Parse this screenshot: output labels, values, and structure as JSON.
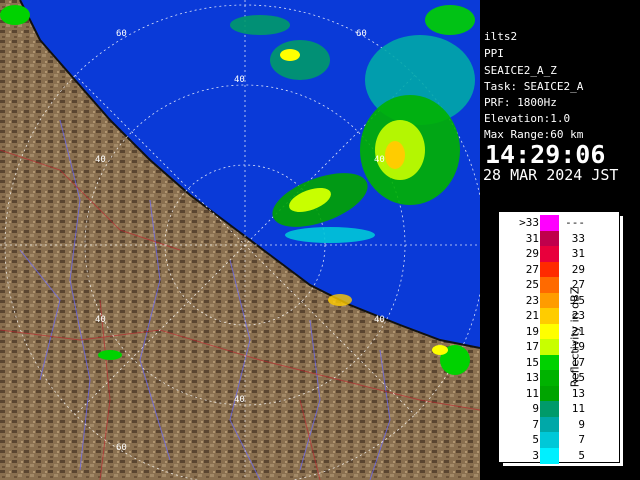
{
  "info_panel": {
    "lines": [
      "ilts2",
      "PPI",
      "SEAICE2_A_Z",
      "Task: SEAICE2_A",
      "PRF: 1800Hz",
      "Elevation:1.0",
      "Max Range:60 km"
    ],
    "time": "14:29:06",
    "date": "28 MAR 2024 JST"
  },
  "legend": {
    "title": "Reflectivity in dBZ",
    "rows": [
      {
        "left": ">33",
        "right": "---",
        "color": "#ff00ff"
      },
      {
        "left": "31",
        "right": "33",
        "color": "#c0004c"
      },
      {
        "left": "29",
        "right": "31",
        "color": "#e8003c"
      },
      {
        "left": "27",
        "right": "29",
        "color": "#ff2a00"
      },
      {
        "left": "25",
        "right": "27",
        "color": "#ff6a00"
      },
      {
        "left": "23",
        "right": "25",
        "color": "#ff9c00"
      },
      {
        "left": "21",
        "right": "23",
        "color": "#ffcc00"
      },
      {
        "left": "19",
        "right": "21",
        "color": "#ffff00"
      },
      {
        "left": "17",
        "right": "19",
        "color": "#c8ff00"
      },
      {
        "left": "15",
        "right": "17",
        "color": "#00d200"
      },
      {
        "left": "13",
        "right": "15",
        "color": "#00b200"
      },
      {
        "left": "11",
        "right": "13",
        "color": "#00a400"
      },
      {
        "left": "9",
        "right": "11",
        "color": "#009a6a"
      },
      {
        "left": "7",
        "right": "9",
        "color": "#00a8a8"
      },
      {
        "left": "5",
        "right": "7",
        "color": "#00c8d8"
      },
      {
        "left": "3",
        "right": "5",
        "color": "#00f0ff"
      }
    ]
  },
  "map": {
    "sea_color": "#0a3ad8",
    "land_color": "#7a6448",
    "range_labels": [
      "60",
      "40",
      "40",
      "60",
      "40",
      "40",
      "40",
      "40",
      "60"
    ]
  }
}
